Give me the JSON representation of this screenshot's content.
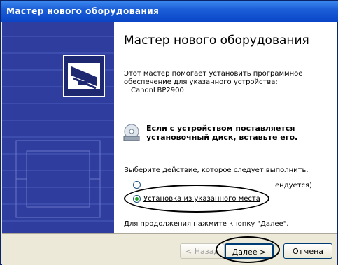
{
  "window": {
    "title": "Мастер нового оборудования"
  },
  "wizard": {
    "heading": "Мастер нового оборудования",
    "intro_line1": "Этот мастер помогает установить программное",
    "intro_line2": "обеспечение для указанного устройства:",
    "device_name": "CanonLBP2900",
    "cd_line1": "Если с устройством поставляется",
    "cd_line2": "установочный диск, вставьте его.",
    "choose_action": "Выберите действие, которое следует выполнить.",
    "option_auto_partial": "ендуется)",
    "option_manual": "Установка из указанного места",
    "continue_hint": "Для продолжения нажмите кнопку \"Далее\"."
  },
  "buttons": {
    "back": "< Назад",
    "next": "Далее >",
    "cancel": "Отмена"
  },
  "icons": {
    "hardware": "hardware-wizard-icon",
    "cd": "cd-icon"
  },
  "colors": {
    "title_bar": "#0a46c8",
    "side_panel": "#2f3d9e",
    "dialog_bg": "#ece9d8",
    "radio_selected": "#21a121"
  }
}
